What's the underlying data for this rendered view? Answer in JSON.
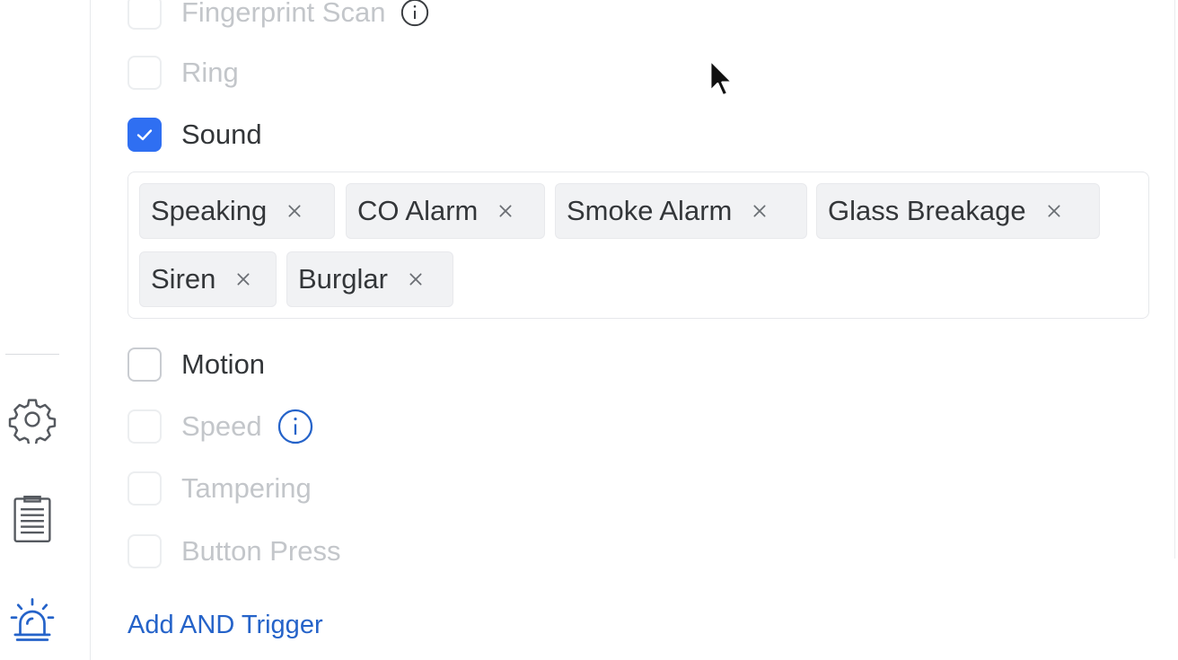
{
  "options": [
    {
      "label": "Fingerprint Scan",
      "checked": false,
      "enabled": false,
      "info": true,
      "info_icon": "info-circle-icon"
    },
    {
      "label": "Ring",
      "checked": false,
      "enabled": false,
      "info": false
    },
    {
      "label": "Sound",
      "checked": true,
      "enabled": true,
      "info": false
    },
    {
      "label": "Motion",
      "checked": false,
      "enabled": true,
      "info": false
    },
    {
      "label": "Speed",
      "checked": false,
      "enabled": false,
      "info": true,
      "info_icon": "info-circle-icon"
    },
    {
      "label": "Tampering",
      "checked": false,
      "enabled": false,
      "info": false
    },
    {
      "label": "Button Press",
      "checked": false,
      "enabled": false,
      "info": false
    }
  ],
  "sound_tags": [
    "Speaking",
    "CO Alarm",
    "Smoke Alarm",
    "Glass Breakage",
    "Siren",
    "Burglar"
  ],
  "add_trigger_label": "Add AND Trigger",
  "sidebar_icons": [
    "gear-icon",
    "clipboard-list-icon",
    "alarm-siren-icon"
  ],
  "colors": {
    "accent": "#2f6ff2",
    "link": "#2563c9",
    "text": "#333639",
    "disabled_text": "#c3c6ca",
    "chip_bg": "#f1f2f4"
  }
}
